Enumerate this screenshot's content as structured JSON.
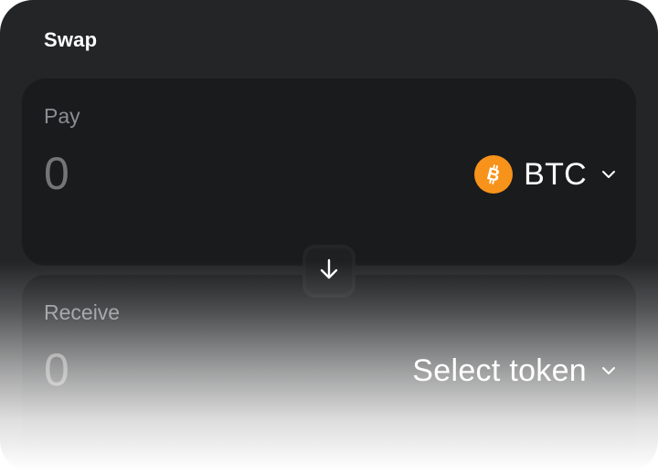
{
  "swap": {
    "title": "Swap"
  },
  "pay": {
    "label": "Pay",
    "amount": "0",
    "token": {
      "symbol": "BTC",
      "icon": "bitcoin-icon",
      "icon_color": "#f7931a"
    }
  },
  "receive": {
    "label": "Receive",
    "amount": "0",
    "token": {
      "symbol": "Select token"
    }
  },
  "switch": {
    "icon": "arrow-down-icon"
  },
  "colors": {
    "background": "#242527",
    "panel": "#1a1b1d",
    "label": "#8b8d91",
    "text": "#ffffff",
    "accent": "#f7931a"
  }
}
